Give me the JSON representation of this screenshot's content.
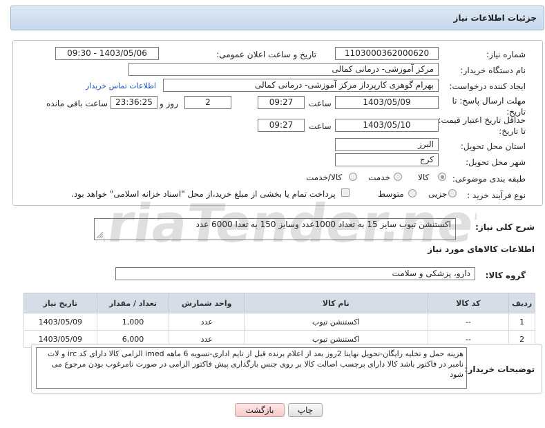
{
  "header": {
    "title": "جزئیات اطلاعات نیاز"
  },
  "form": {
    "need_number": {
      "label": "شماره نیاز:",
      "value": "1103000362000620"
    },
    "announce_datetime": {
      "label": "تاریخ و ساعت اعلان عمومی:",
      "value": "1403/05/06 - 09:30"
    },
    "buyer_org": {
      "label": "نام دستگاه خریدار:",
      "value": "مرکز آموزشی- درمانی کمالی"
    },
    "requester": {
      "label": "ایجاد کننده درخواست:",
      "value": "بهرام گوهری کارپرداز مرکز آموزشی- درمانی کمالی",
      "contact_link": "اطلاعات تماس خریدار"
    },
    "response_deadline": {
      "label": "مهلت ارسال پاسخ: تا تاریخ:",
      "date": "1403/05/09",
      "time_label": "ساعت",
      "time": "09:27",
      "days": "2",
      "days_label": "روز و",
      "remaining": "23:36:25",
      "remaining_label": "ساعت باقی مانده"
    },
    "price_validity": {
      "label": "حداقل تاریخ اعتبار قیمت: تا تاریخ:",
      "date": "1403/05/10",
      "time_label": "ساعت",
      "time": "09:27"
    },
    "province": {
      "label": "استان محل تحویل:",
      "value": "البرز"
    },
    "city": {
      "label": "شهر محل تحویل:",
      "value": "کرج"
    },
    "category": {
      "label": "طبقه بندی موضوعی:",
      "options": [
        "کالا",
        "خدمت",
        "کالا/خدمت"
      ]
    },
    "purchase_type": {
      "label": "نوع فرآیند خرید :",
      "options": [
        "جزیی",
        "متوسط"
      ],
      "payment_note": "پرداخت تمام یا بخشی از مبلغ خرید،از محل \"اسناد خزانه اسلامی\" خواهد بود."
    }
  },
  "description": {
    "label": "شرح کلی نیاز:",
    "value": "اکستنشن تیوب سایز 15 به تعداد 1000عدد وسایز 150 به تعدا 6000 عدد"
  },
  "goods_info": {
    "title": "اطلاعات کالاهای مورد نیاز"
  },
  "goods_group": {
    "label": "گروه کالا:",
    "value": "دارو، پزشکی و سلامت"
  },
  "table": {
    "headers": [
      "ردیف",
      "کد کالا",
      "نام کالا",
      "واحد شمارش",
      "تعداد / مقدار",
      "تاریخ نیاز"
    ],
    "rows": [
      [
        "1",
        "--",
        "اکستنشن تیوب",
        "عدد",
        "1,000",
        "1403/05/09"
      ],
      [
        "2",
        "--",
        "اکستنشن تیوب",
        "عدد",
        "6,000",
        "1403/05/09"
      ]
    ]
  },
  "buyer_notes": {
    "label": "توضیحات خریدار:",
    "value": "هزینه حمل و تخلیه رایگان-تحویل نهایتا 2روز بعد از اعلام برنده قبل از تایم اداری-تسویه 6 ماهه imed الزامی کالا دارای کد irc و لات نامبر در فاکتور باشد کالا دارای برچسب اصالت کالا بر روی جنس بارگذاری پیش فاکتور الزامی در صورت نامرغوب بودن مرجوع می شود"
  },
  "buttons": {
    "print": "چاپ",
    "back": "بازگشت"
  },
  "watermark": {
    "text": "AriaTender.net"
  }
}
